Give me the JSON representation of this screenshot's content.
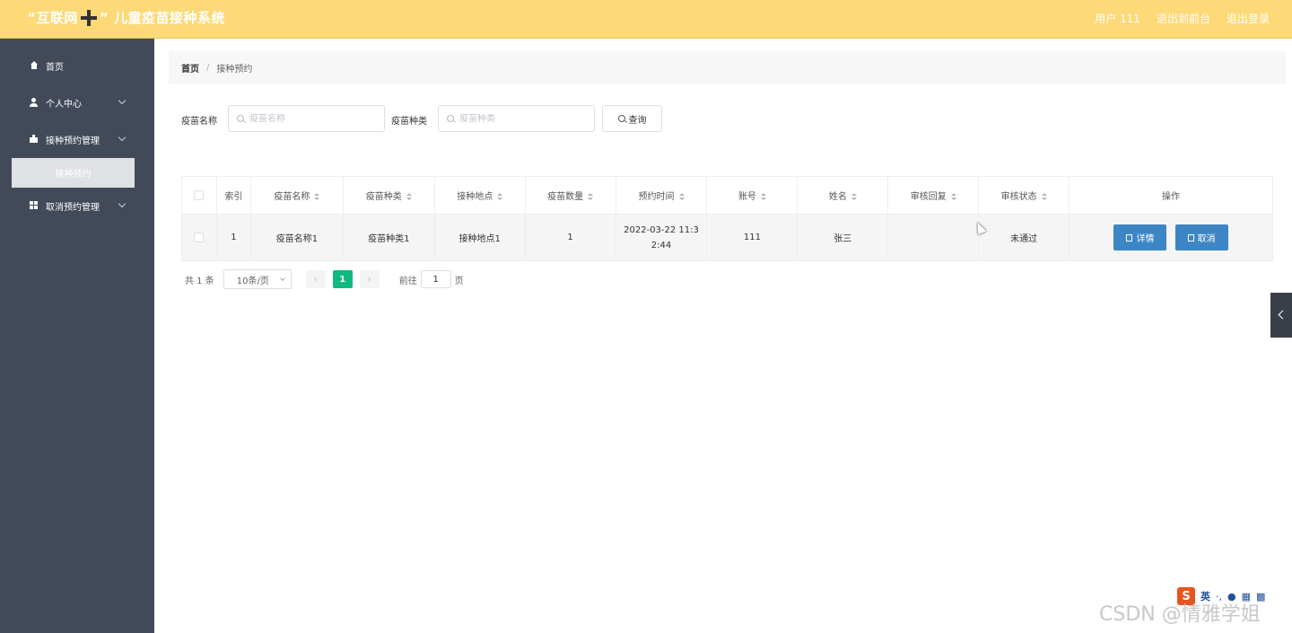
{
  "header": {
    "app_title_left": "“互联网",
    "app_title_right": "” 儿童疫苗接种系统",
    "user_label": "用户 111",
    "exit_front_label": "退出到前台",
    "logout_label": "退出登录"
  },
  "sidebar": {
    "items": [
      {
        "label": "首页",
        "icon": "home-icon"
      },
      {
        "label": "个人中心",
        "icon": "user-icon"
      },
      {
        "label": "接种预约管理",
        "icon": "thumbs-up-icon"
      },
      {
        "label": "取消预约管理",
        "icon": "grid-icon"
      }
    ],
    "active_sub_item": "接种预约"
  },
  "breadcrumb": {
    "home": "首页",
    "separator": "/",
    "current": "接种预约"
  },
  "search": {
    "vaccine_name_label": "疫苗名称",
    "vaccine_name_placeholder": "疫苗名称",
    "vaccine_type_label": "疫苗种类",
    "vaccine_type_placeholder": "疫苗种类",
    "query_label": "查询"
  },
  "table": {
    "columns": [
      "索引",
      "疫苗名称",
      "疫苗种类",
      "接种地点",
      "疫苗数量",
      "预约时间",
      "账号",
      "姓名",
      "审核回复",
      "审核状态",
      "操作"
    ],
    "rows": [
      {
        "index": "1",
        "vaccine_name": "疫苗名称1",
        "vaccine_type": "疫苗种类1",
        "location": "接种地点1",
        "quantity": "1",
        "appointment_time_line1": "2022-03-22 11:3",
        "appointment_time_line2": "2:44",
        "account": "111",
        "name": "张三",
        "review_reply": "",
        "review_status": "未通过",
        "detail_label": "详情",
        "cancel_label": "取消"
      }
    ]
  },
  "pagination": {
    "total_label": "共 1 条",
    "page_size": "10条/页",
    "current_page": "1",
    "goto_label": "前往",
    "goto_value": "1",
    "page_unit": "页"
  },
  "ime": {
    "logo": "S",
    "lang": "英"
  },
  "watermark": "CSDN @情雅学姐",
  "colors": {
    "header": "#fdd978",
    "sidebar": "#424a5a",
    "primary_button": "#3d86c6",
    "active_page": "#10b981"
  }
}
